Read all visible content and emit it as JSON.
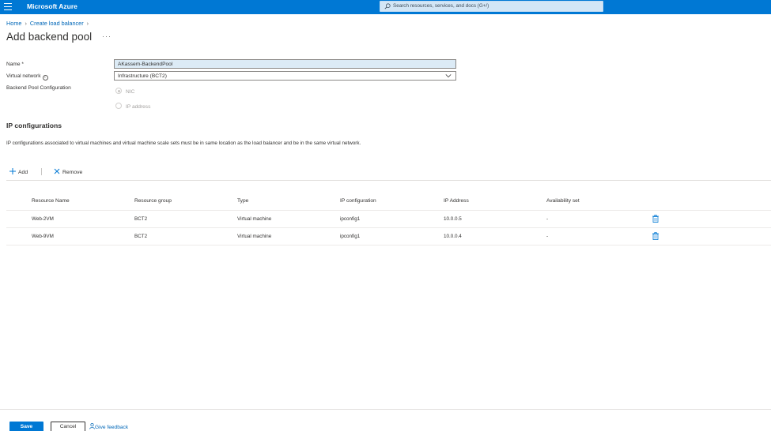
{
  "app": {
    "brand": "Microsoft Azure"
  },
  "search": {
    "placeholder": "Search resources, services, and docs (G+/)"
  },
  "breadcrumb": {
    "items": [
      "Home",
      "Create load balancer"
    ]
  },
  "page": {
    "title": "Add backend pool",
    "more": "···"
  },
  "form": {
    "name_label": "Name *",
    "name_value": "AKassem-BackendPool",
    "vnet_label": "Virtual network",
    "vnet_value": "Infrastructure (BCT2)",
    "pool_config_label": "Backend Pool Configuration",
    "options": [
      {
        "label": "NIC",
        "selected": true
      },
      {
        "label": "IP address",
        "selected": false
      }
    ]
  },
  "ipconfig": {
    "title": "IP configurations",
    "description": "IP configurations associated to virtual machines and virtual machine scale sets must be in same location as the load balancer and be in the same virtual network.",
    "add_label": "Add",
    "remove_label": "Remove",
    "columns": [
      "Resource Name",
      "Resource group",
      "Type",
      "IP configuration",
      "IP Address",
      "Availability set"
    ],
    "rows": [
      {
        "name": "Web-2VM",
        "group": "BCT2",
        "type": "Virtual machine",
        "ipconfig": "ipconfig1",
        "ip": "10.0.0.5",
        "avset": "-"
      },
      {
        "name": "Web-9VM",
        "group": "BCT2",
        "type": "Virtual machine",
        "ipconfig": "ipconfig1",
        "ip": "10.0.0.4",
        "avset": "-"
      }
    ]
  },
  "footer": {
    "save_label": "Save",
    "cancel_label": "Cancel",
    "feedback_label": "Give feedback"
  },
  "colors": {
    "accent": "#0078d4",
    "link": "#0067b8"
  }
}
